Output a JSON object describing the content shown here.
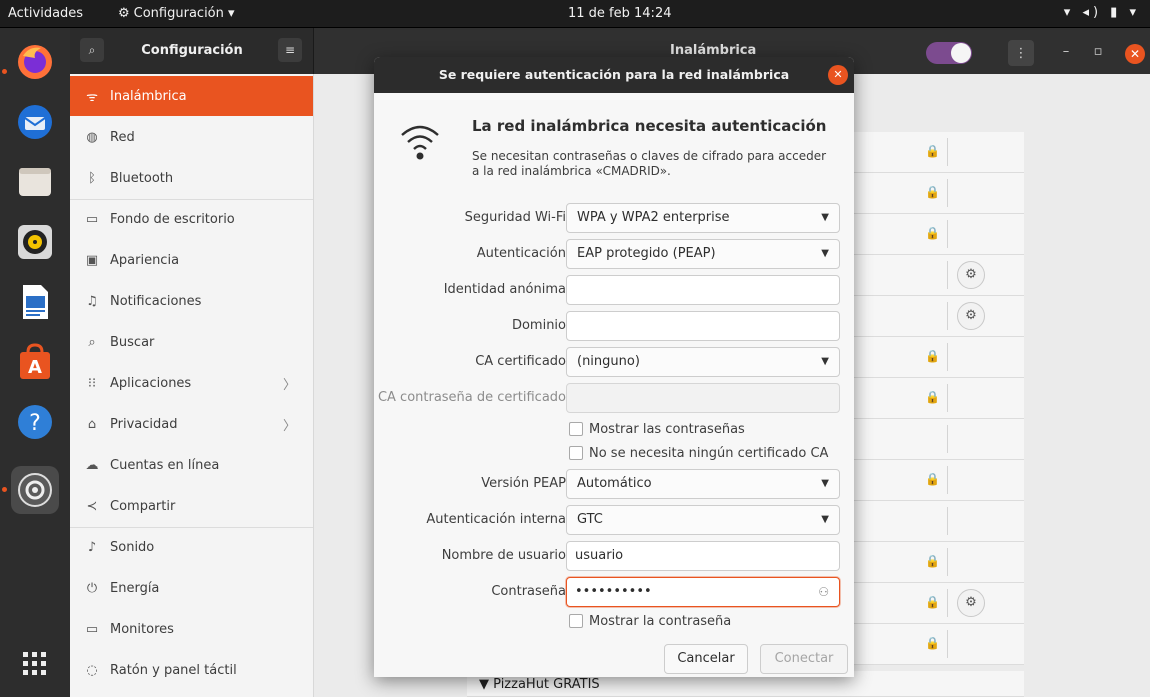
{
  "topbar": {
    "activities": "Actividades",
    "app_menu": "Configuración ▾",
    "clock": "11 de feb  14:24",
    "tray": "▾ ◂) ▮ ▾"
  },
  "dock": {
    "apps": [
      "firefox",
      "thunderbird",
      "files",
      "rhythmbox",
      "libreoffice-writer",
      "ubuntu-software",
      "help",
      "settings",
      "show-applications"
    ]
  },
  "settings": {
    "sidebar_title": "Configuración",
    "panel_title": "Inalámbrica",
    "nav": [
      {
        "icon": "ᯤ",
        "label": "Inalámbrica",
        "selected": true
      },
      {
        "icon": "◍",
        "label": "Red"
      },
      {
        "icon": "ᛒ",
        "label": "Bluetooth"
      },
      {
        "icon": "▭",
        "label": "Fondo de escritorio"
      },
      {
        "icon": "▣",
        "label": "Apariencia"
      },
      {
        "icon": "♫",
        "label": "Notificaciones"
      },
      {
        "icon": "⌕",
        "label": "Buscar"
      },
      {
        "icon": "⁝⁝",
        "label": "Aplicaciones",
        "chevron": "〉"
      },
      {
        "icon": "⌂",
        "label": "Privacidad",
        "chevron": "〉"
      },
      {
        "icon": "☁",
        "label": "Cuentas en línea"
      },
      {
        "icon": "≺",
        "label": "Compartir"
      },
      {
        "icon": "♪",
        "label": "Sonido"
      },
      {
        "icon": "⏻",
        "label": "Energía"
      },
      {
        "icon": "▭",
        "label": "Monitores"
      },
      {
        "icon": "◌",
        "label": "Ratón y panel táctil"
      }
    ],
    "visible_network": "PizzaHut GRATIS"
  },
  "dialog": {
    "title": "Se requiere autenticación para la red inalámbrica",
    "heading": "La red inalámbrica necesita autenticación",
    "description": "Se necesitan contraseñas o claves de cifrado para acceder a la red inalámbrica «CMADRID».",
    "fields": {
      "wifi_security": {
        "label": "Seguridad Wi-Fi",
        "value": "WPA y WPA2 enterprise"
      },
      "authentication": {
        "label": "Autenticación",
        "value": "EAP protegido (PEAP)"
      },
      "anonymous_identity": {
        "label": "Identidad anónima",
        "value": ""
      },
      "domain": {
        "label": "Dominio",
        "value": ""
      },
      "ca_certificate": {
        "label": "CA certificado",
        "value": "(ninguno)"
      },
      "ca_cert_password": {
        "label": "CA contraseña de certificado",
        "value": ""
      },
      "show_passwords": {
        "label": "Mostrar las contraseñas",
        "checked": false
      },
      "no_ca_required": {
        "label": "No se necesita ningún certificado CA",
        "checked": false
      },
      "peap_version": {
        "label": "Versión PEAP",
        "value": "Automático"
      },
      "inner_auth": {
        "label": "Autenticación interna",
        "value": "GTC"
      },
      "username": {
        "label": "Nombre de usuario",
        "value": "usuario"
      },
      "password": {
        "label": "Contraseña",
        "value": "••••••••••"
      },
      "show_password": {
        "label": "Mostrar la contraseña",
        "checked": false
      }
    },
    "buttons": {
      "cancel": "Cancelar",
      "connect": "Conectar"
    }
  },
  "colors": {
    "accent": "#e95420",
    "topbar": "#1d1d1d",
    "dock": "#2d2d2d",
    "headerbar": "#303030"
  }
}
